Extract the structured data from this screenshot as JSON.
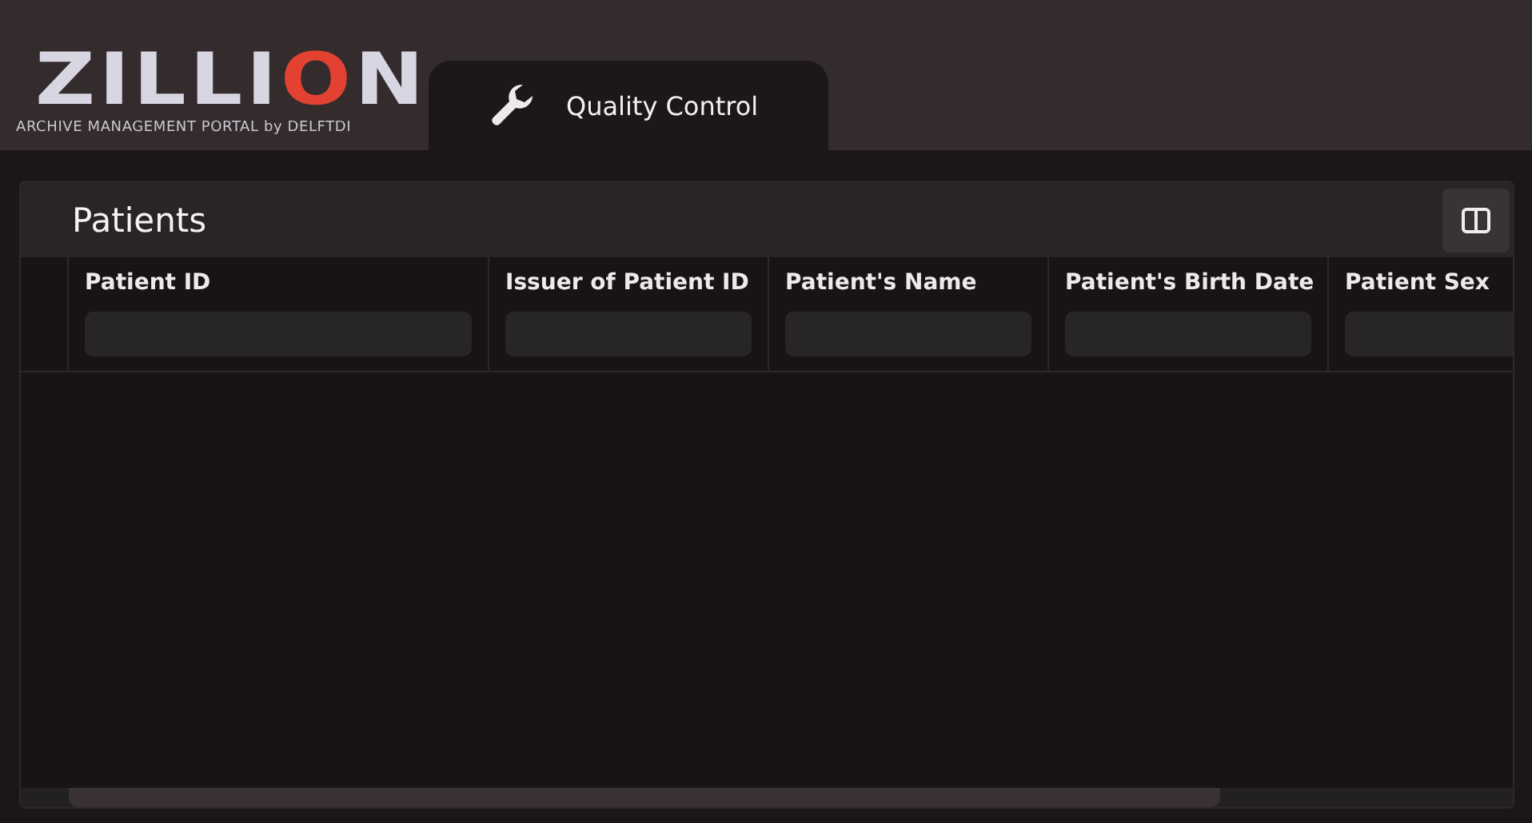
{
  "logo": {
    "name": "ZILLION",
    "tagline": "ARCHIVE MANAGEMENT PORTAL by DELFTDI"
  },
  "tabs": [
    {
      "label": "Quality Control",
      "selected": true
    }
  ],
  "panel": {
    "title": "Patients"
  },
  "columns": [
    {
      "label": "Patient ID"
    },
    {
      "label": "Issuer of Patient ID"
    },
    {
      "label": "Patient's Name"
    },
    {
      "label": "Patient's Birth Date"
    },
    {
      "label": "Patient Sex"
    }
  ]
}
